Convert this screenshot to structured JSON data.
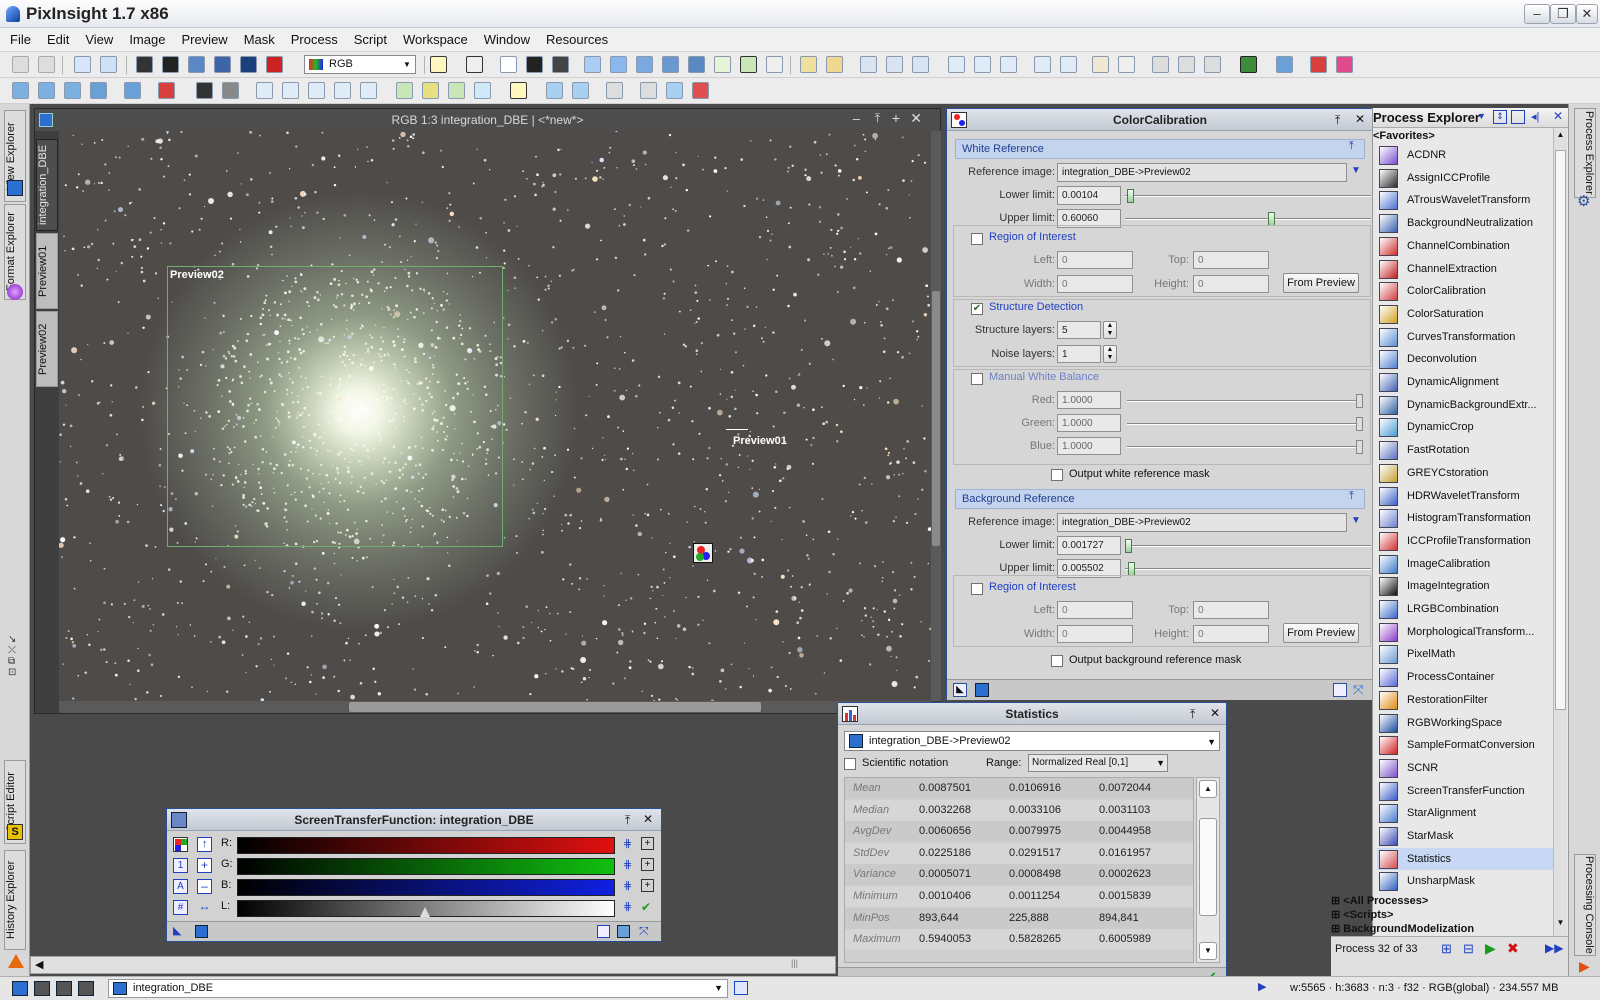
{
  "app": {
    "title": "PixInsight 1.7 x86"
  },
  "window_buttons": [
    "–",
    "❐",
    "✕"
  ],
  "menu": [
    "File",
    "Edit",
    "View",
    "Image",
    "Preview",
    "Mask",
    "Process",
    "Script",
    "Workspace",
    "Window",
    "Resources"
  ],
  "toolbar": {
    "channel_select": "RGB"
  },
  "side_tabs_left": {
    "view_explorer": "View Explorer",
    "format_explorer": "Format Explorer",
    "script_editor": "Script Editor",
    "history_explorer": "History Explorer"
  },
  "side_tabs_right": {
    "process_explorer": "Process Explorer",
    "processing_console": "Processing Console"
  },
  "image_window": {
    "title": "RGB 1:3 integration_DBE | <*new*>",
    "tabs": [
      "integration_DBE",
      "Preview01",
      "Preview02"
    ],
    "preview02_label": "Preview02",
    "preview01_label": "Preview01"
  },
  "color_calibration": {
    "title": "ColorCalibration",
    "white_reference": {
      "section": "White Reference",
      "reference_label": "Reference image:",
      "reference_value": "integration_DBE->Preview02",
      "lower_label": "Lower limit:",
      "lower_value": "0.00104",
      "lower_fraction": 0.0104,
      "upper_label": "Upper limit:",
      "upper_value": "0.60060",
      "upper_fraction": 0.6006,
      "roi_label": "Region of Interest",
      "left_label": "Left:",
      "left_value": "0",
      "top_label": "Top:",
      "top_value": "0",
      "width_label": "Width:",
      "width_value": "0",
      "height_label": "Height:",
      "height_value": "0",
      "from_preview": "From Preview",
      "structure_label": "Structure Detection",
      "structure_checked": true,
      "structure_layers_label": "Structure layers:",
      "structure_layers_value": "5",
      "noise_layers_label": "Noise layers:",
      "noise_layers_value": "1",
      "manual_label": "Manual White Balance",
      "red_label": "Red:",
      "red_value": "1.0000",
      "green_label": "Green:",
      "green_value": "1.0000",
      "blue_label": "Blue:",
      "blue_value": "1.0000",
      "output_mask_label": "Output white reference mask"
    },
    "background_reference": {
      "section": "Background Reference",
      "reference_label": "Reference image:",
      "reference_value": "integration_DBE->Preview02",
      "lower_label": "Lower limit:",
      "lower_value": "0.001727",
      "lower_fraction": 0.001727,
      "upper_label": "Upper limit:",
      "upper_value": "0.005502",
      "upper_fraction": 0.005502,
      "roi_label": "Region of Interest",
      "left_label": "Left:",
      "left_value": "0",
      "top_label": "Top:",
      "top_value": "0",
      "width_label": "Width:",
      "width_value": "0",
      "height_label": "Height:",
      "height_value": "0",
      "from_preview": "From Preview",
      "output_mask_label": "Output background reference mask"
    }
  },
  "process_explorer": {
    "title": "Process Explorer",
    "favorites_label": "<Favorites>",
    "items": [
      "ACDNR",
      "AssignICCProfile",
      "ATrousWaveletTransform",
      "BackgroundNeutralization",
      "ChannelCombination",
      "ChannelExtraction",
      "ColorCalibration",
      "ColorSaturation",
      "CurvesTransformation",
      "Deconvolution",
      "DynamicAlignment",
      "DynamicBackgroundExtr...",
      "DynamicCrop",
      "FastRotation",
      "GREYCstoration",
      "HDRWaveletTransform",
      "HistogramTransformation",
      "ICCProfileTransformation",
      "ImageCalibration",
      "ImageIntegration",
      "LRGBCombination",
      "MorphologicalTransform...",
      "PixelMath",
      "ProcessContainer",
      "RestorationFilter",
      "RGBWorkingSpace",
      "SampleFormatConversion",
      "SCNR",
      "ScreenTransferFunction",
      "StarAlignment",
      "StarMask",
      "Statistics",
      "UnsharpMask"
    ],
    "selected": "Statistics",
    "groups": [
      "<All Processes>",
      "<Scripts>",
      "BackgroundModelization"
    ],
    "footer": "Process 32 of 33"
  },
  "statistics": {
    "title": "Statistics",
    "view": "integration_DBE->Preview02",
    "scientific_label": "Scientific notation",
    "range_label": "Range:",
    "range_value": "Normalized Real [0,1]",
    "rows": [
      {
        "name": "Mean",
        "r": "0.0087501",
        "g": "0.0106916",
        "b": "0.0072044"
      },
      {
        "name": "Median",
        "r": "0.0032268",
        "g": "0.0033106",
        "b": "0.0031103"
      },
      {
        "name": "AvgDev",
        "r": "0.0060656",
        "g": "0.0079975",
        "b": "0.0044958"
      },
      {
        "name": "StdDev",
        "r": "0.0225186",
        "g": "0.0291517",
        "b": "0.0161957"
      },
      {
        "name": "Variance",
        "r": "0.0005071",
        "g": "0.0008498",
        "b": "0.0002623"
      },
      {
        "name": "Minimum",
        "r": "0.0010406",
        "g": "0.0011254",
        "b": "0.0015839"
      },
      {
        "name": "MinPos",
        "r": "893,644",
        "g": "225,888",
        "b": "894,841"
      },
      {
        "name": "Maximum",
        "r": "0.5940053",
        "g": "0.5828265",
        "b": "0.6005989"
      }
    ]
  },
  "stf": {
    "title": "ScreenTransferFunction: integration_DBE",
    "channels": [
      "R:",
      "G:",
      "B:",
      "L:"
    ],
    "colors": {
      "r": "#e01010",
      "g": "#10c010",
      "b": "#1020e0"
    }
  },
  "statusbar": {
    "view": "integration_DBE",
    "info": "w:5565 · h:3683 · n:3 · f32 · RGB(global) · 234.557 MB"
  },
  "colors": {
    "accent": "#2a4f9a",
    "section_bg": "#c4d3ee",
    "selection": "#c8d8f4"
  }
}
